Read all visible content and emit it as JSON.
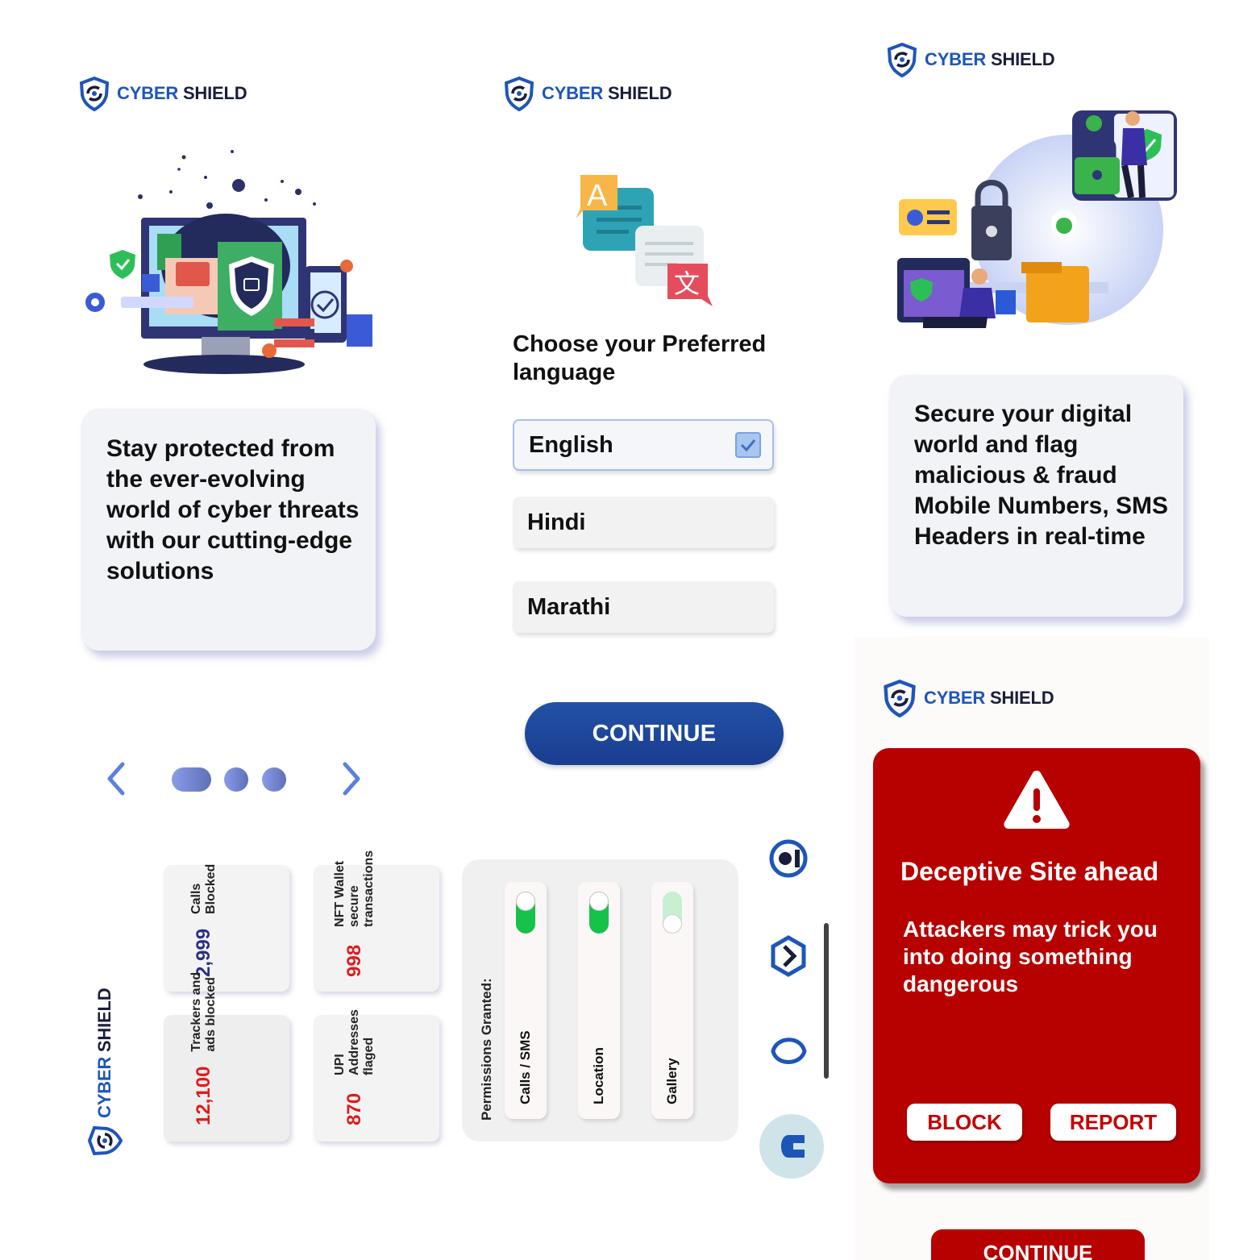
{
  "brand": {
    "word1": "CYBER",
    "word2": "SHIELD"
  },
  "onboarding1": {
    "text": "Stay protected from the ever-evolving world of cyber threats with our cutting-edge solutions"
  },
  "onboarding3": {
    "text": "Secure your digital world and flag malicious & fraud Mobile Numbers, SMS Headers in real-time"
  },
  "language": {
    "title": "Choose your Preferred language",
    "options": [
      {
        "label": "English",
        "selected": true
      },
      {
        "label": "Hindi",
        "selected": false
      },
      {
        "label": "Marathi",
        "selected": false
      }
    ],
    "continue_label": "CONTINUE"
  },
  "pager": {
    "prev_icon": "chevron-left-icon",
    "next_icon": "chevron-right-icon",
    "active_index": 0,
    "count": 3
  },
  "dashboard": {
    "stats": [
      {
        "value": "2,999",
        "label": "Calls Blocked",
        "color": "#2b2f86"
      },
      {
        "value": "998",
        "label": "NFT Wallet secure transactions",
        "color": "#e01b1b"
      },
      {
        "value": "12,100",
        "label": "Trackers and ads blocked",
        "color": "#e01b1b"
      },
      {
        "value": "870",
        "label": "UPI Addresses flaged",
        "color": "#e01b1b"
      }
    ],
    "permissions_title": "Permissions Granted:",
    "permissions": [
      {
        "label": "Calls / SMS",
        "granted": true
      },
      {
        "label": "Location",
        "granted": true
      },
      {
        "label": "Gallery",
        "granted": false
      }
    ],
    "nav_icons": [
      "ring-nav-icon",
      "hexagon-nav-icon",
      "lemon-nav-icon",
      "c-nav-icon"
    ]
  },
  "warning": {
    "title": "Deceptive Site ahead",
    "body": "Attackers may trick you into doing something dangerous",
    "block_label": "BLOCK",
    "report_label": "REPORT",
    "continue_label": "CONTINUE"
  },
  "colors": {
    "brand_blue": "#1e56b8",
    "brand_navy": "#1a1d3a",
    "alert_red": "#b70000",
    "accent_red": "#e01b1b"
  }
}
